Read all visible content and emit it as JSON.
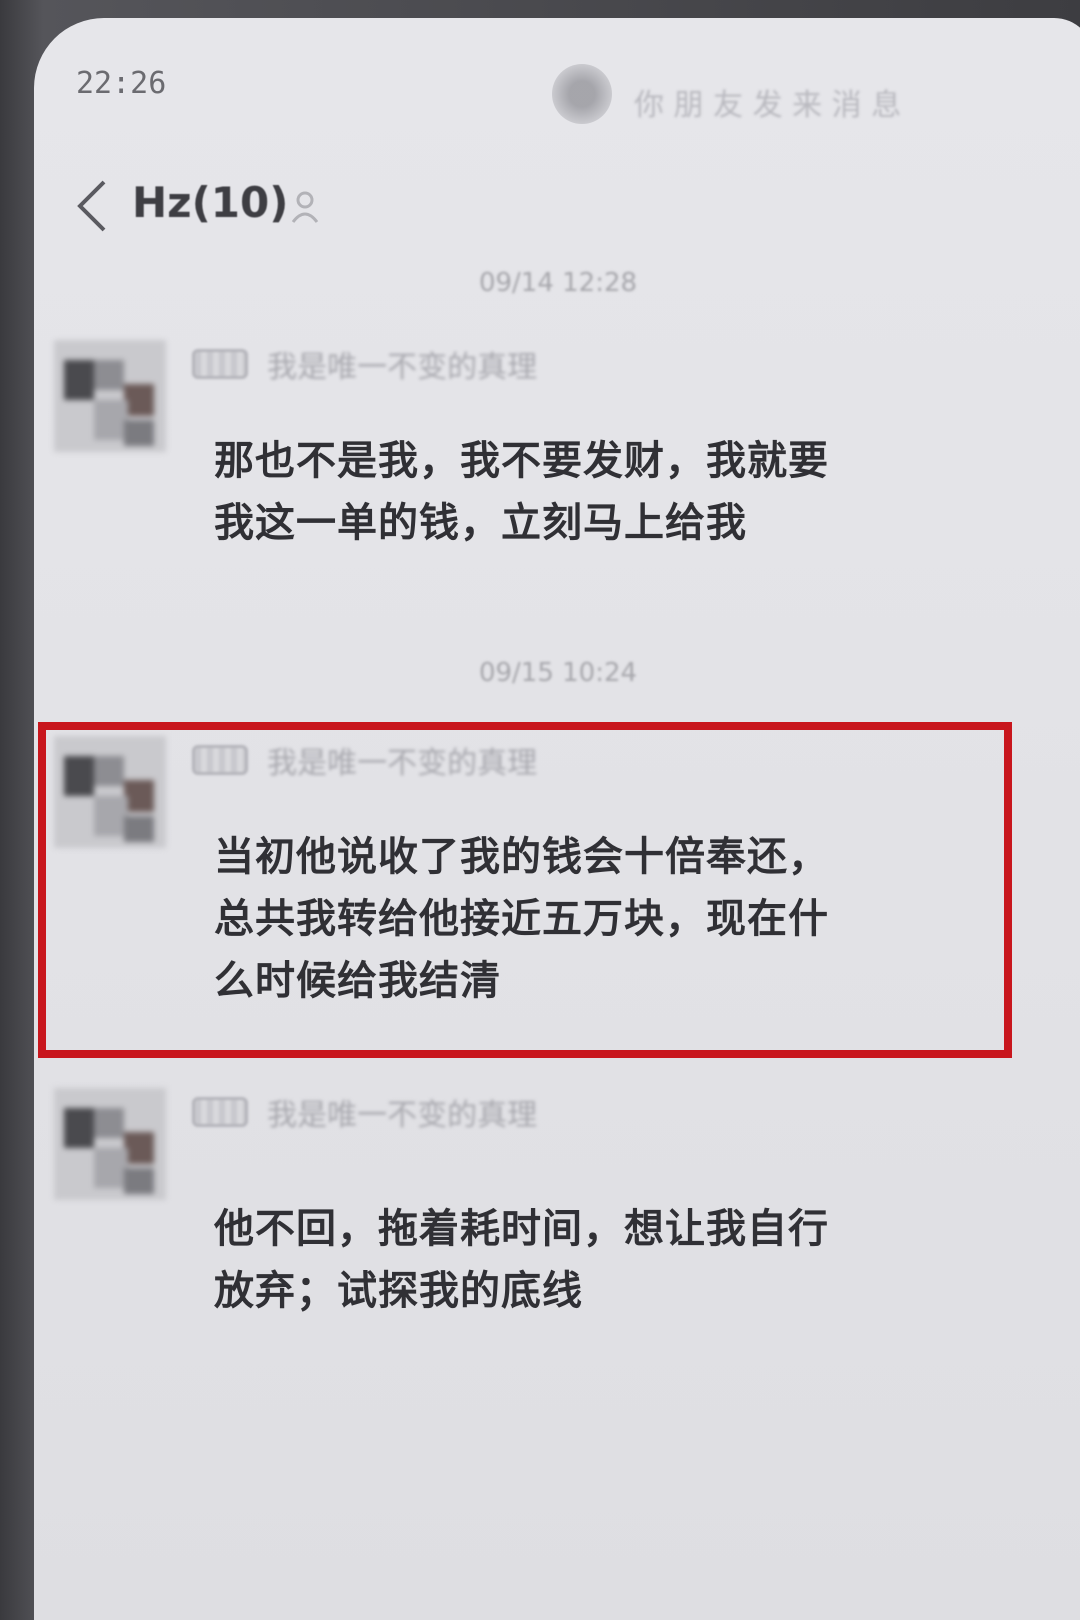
{
  "status_bar": {
    "time": "22:26",
    "notification_text": "你 朋 友 发 来 消 息"
  },
  "header": {
    "back_icon": "chevron-left-icon",
    "title": "Hz(10)",
    "group_icon": "group-icon"
  },
  "messages": [
    {
      "timestamp": "09/14 12:28",
      "sender": "我是唯一不变的真理",
      "text_lines": [
        "那也不是我，我不要发财，我就要",
        "我这一单的钱，立刻马上给我"
      ]
    },
    {
      "timestamp": "09/15 10:24",
      "sender": "我是唯一不变的真理",
      "text_lines": [
        "当初他说收了我的钱会十倍奉还，",
        "总共我转给他接近五万块，现在什",
        "么时候给我结清"
      ],
      "highlighted": true
    },
    {
      "sender": "我是唯一不变的真理",
      "text_lines": [
        "他不回，拖着耗时间，想让我自行",
        "放弃；试探我的底线"
      ]
    }
  ],
  "colors": {
    "highlight_border": "#c8161d",
    "screen_bg": "#e4e4e8",
    "text": "#303035"
  }
}
